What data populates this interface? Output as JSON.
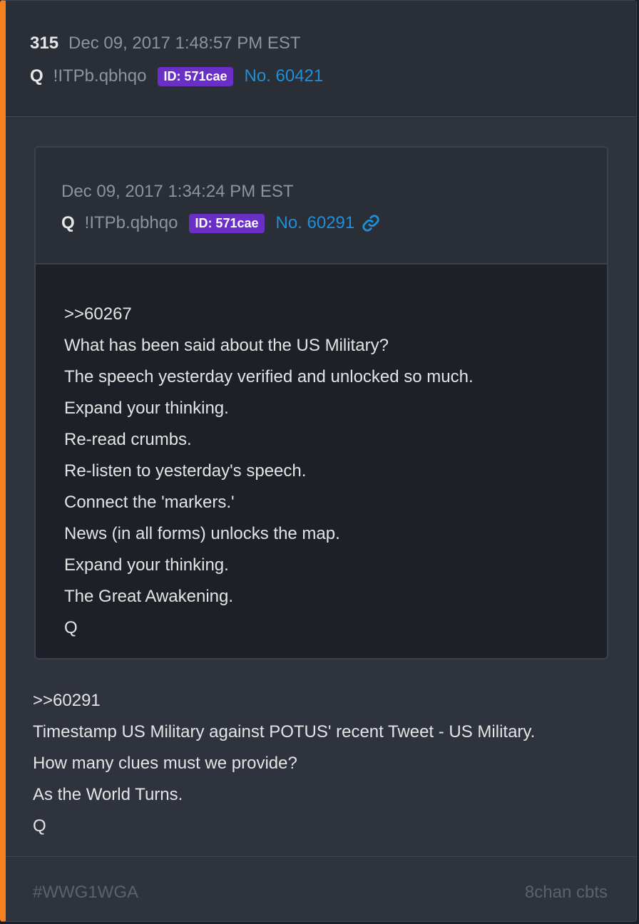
{
  "post": {
    "number": "315",
    "datetime": "Dec 09, 2017 1:48:57 PM EST",
    "author": "Q",
    "tripcode": "!ITPb.qbhqo",
    "id_badge": "ID: 571cae",
    "post_no": "No. 60421"
  },
  "quoted": {
    "datetime": "Dec 09, 2017 1:34:24 PM EST",
    "author": "Q",
    "tripcode": "!ITPb.qbhqo",
    "id_badge": "ID: 571cae",
    "post_no": "No. 60291",
    "link_icon": "link-icon",
    "lines": [
      ">>60267",
      "What has been said about the US Military?",
      "The speech yesterday verified and unlocked so much.",
      "Expand your thinking.",
      "Re-read crumbs.",
      "Re-listen to yesterday's speech.",
      "Connect the 'markers.'",
      "News (in all forms) unlocks the map.",
      "Expand your thinking.",
      "The Great Awakening.",
      "Q"
    ]
  },
  "message": {
    "lines": [
      ">>60291",
      "Timestamp US Military against POTUS' recent Tweet - US Military.",
      "How many clues must we provide?",
      "As the World Turns.",
      "Q"
    ]
  },
  "footer": {
    "tag": "#WWG1WGA",
    "source": "8chan cbts"
  },
  "colors": {
    "accent": "#f5801e",
    "id_badge": "#6a2fc4",
    "link": "#1f8fd8"
  }
}
